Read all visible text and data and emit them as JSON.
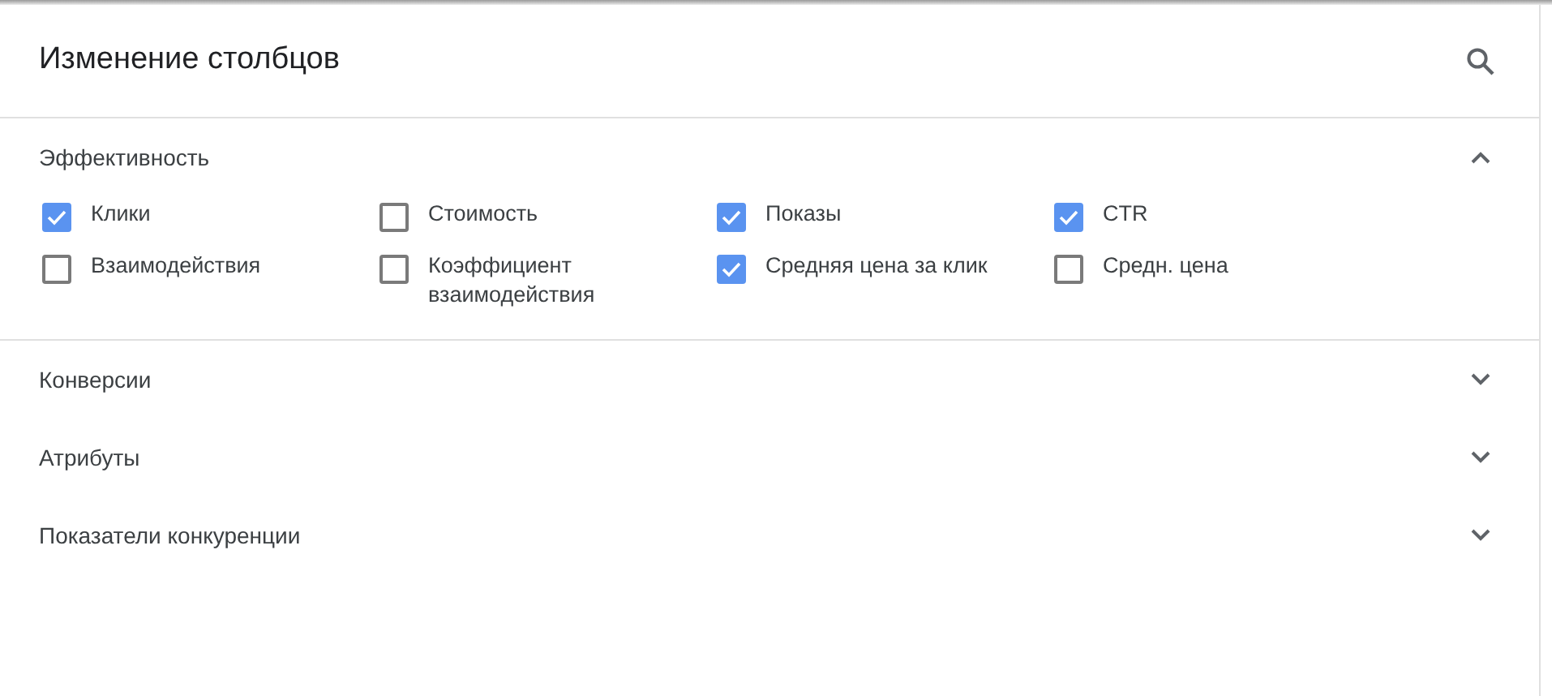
{
  "dialog": {
    "title": "Изменение столбцов"
  },
  "sections": [
    {
      "title": "Эффективность",
      "expanded": true,
      "options": [
        {
          "label": "Клики",
          "checked": true
        },
        {
          "label": "Стоимость",
          "checked": false
        },
        {
          "label": "Показы",
          "checked": true
        },
        {
          "label": "CTR",
          "checked": true
        },
        {
          "label": "Взаимодействия",
          "checked": false
        },
        {
          "label": "Коэффициент взаимодействия",
          "checked": false
        },
        {
          "label": "Средняя цена за клик",
          "checked": true
        },
        {
          "label": "Средн. цена",
          "checked": false
        }
      ]
    },
    {
      "title": "Конверсии",
      "expanded": false
    },
    {
      "title": "Атрибуты",
      "expanded": false
    },
    {
      "title": "Показатели конкуренции",
      "expanded": false
    }
  ]
}
